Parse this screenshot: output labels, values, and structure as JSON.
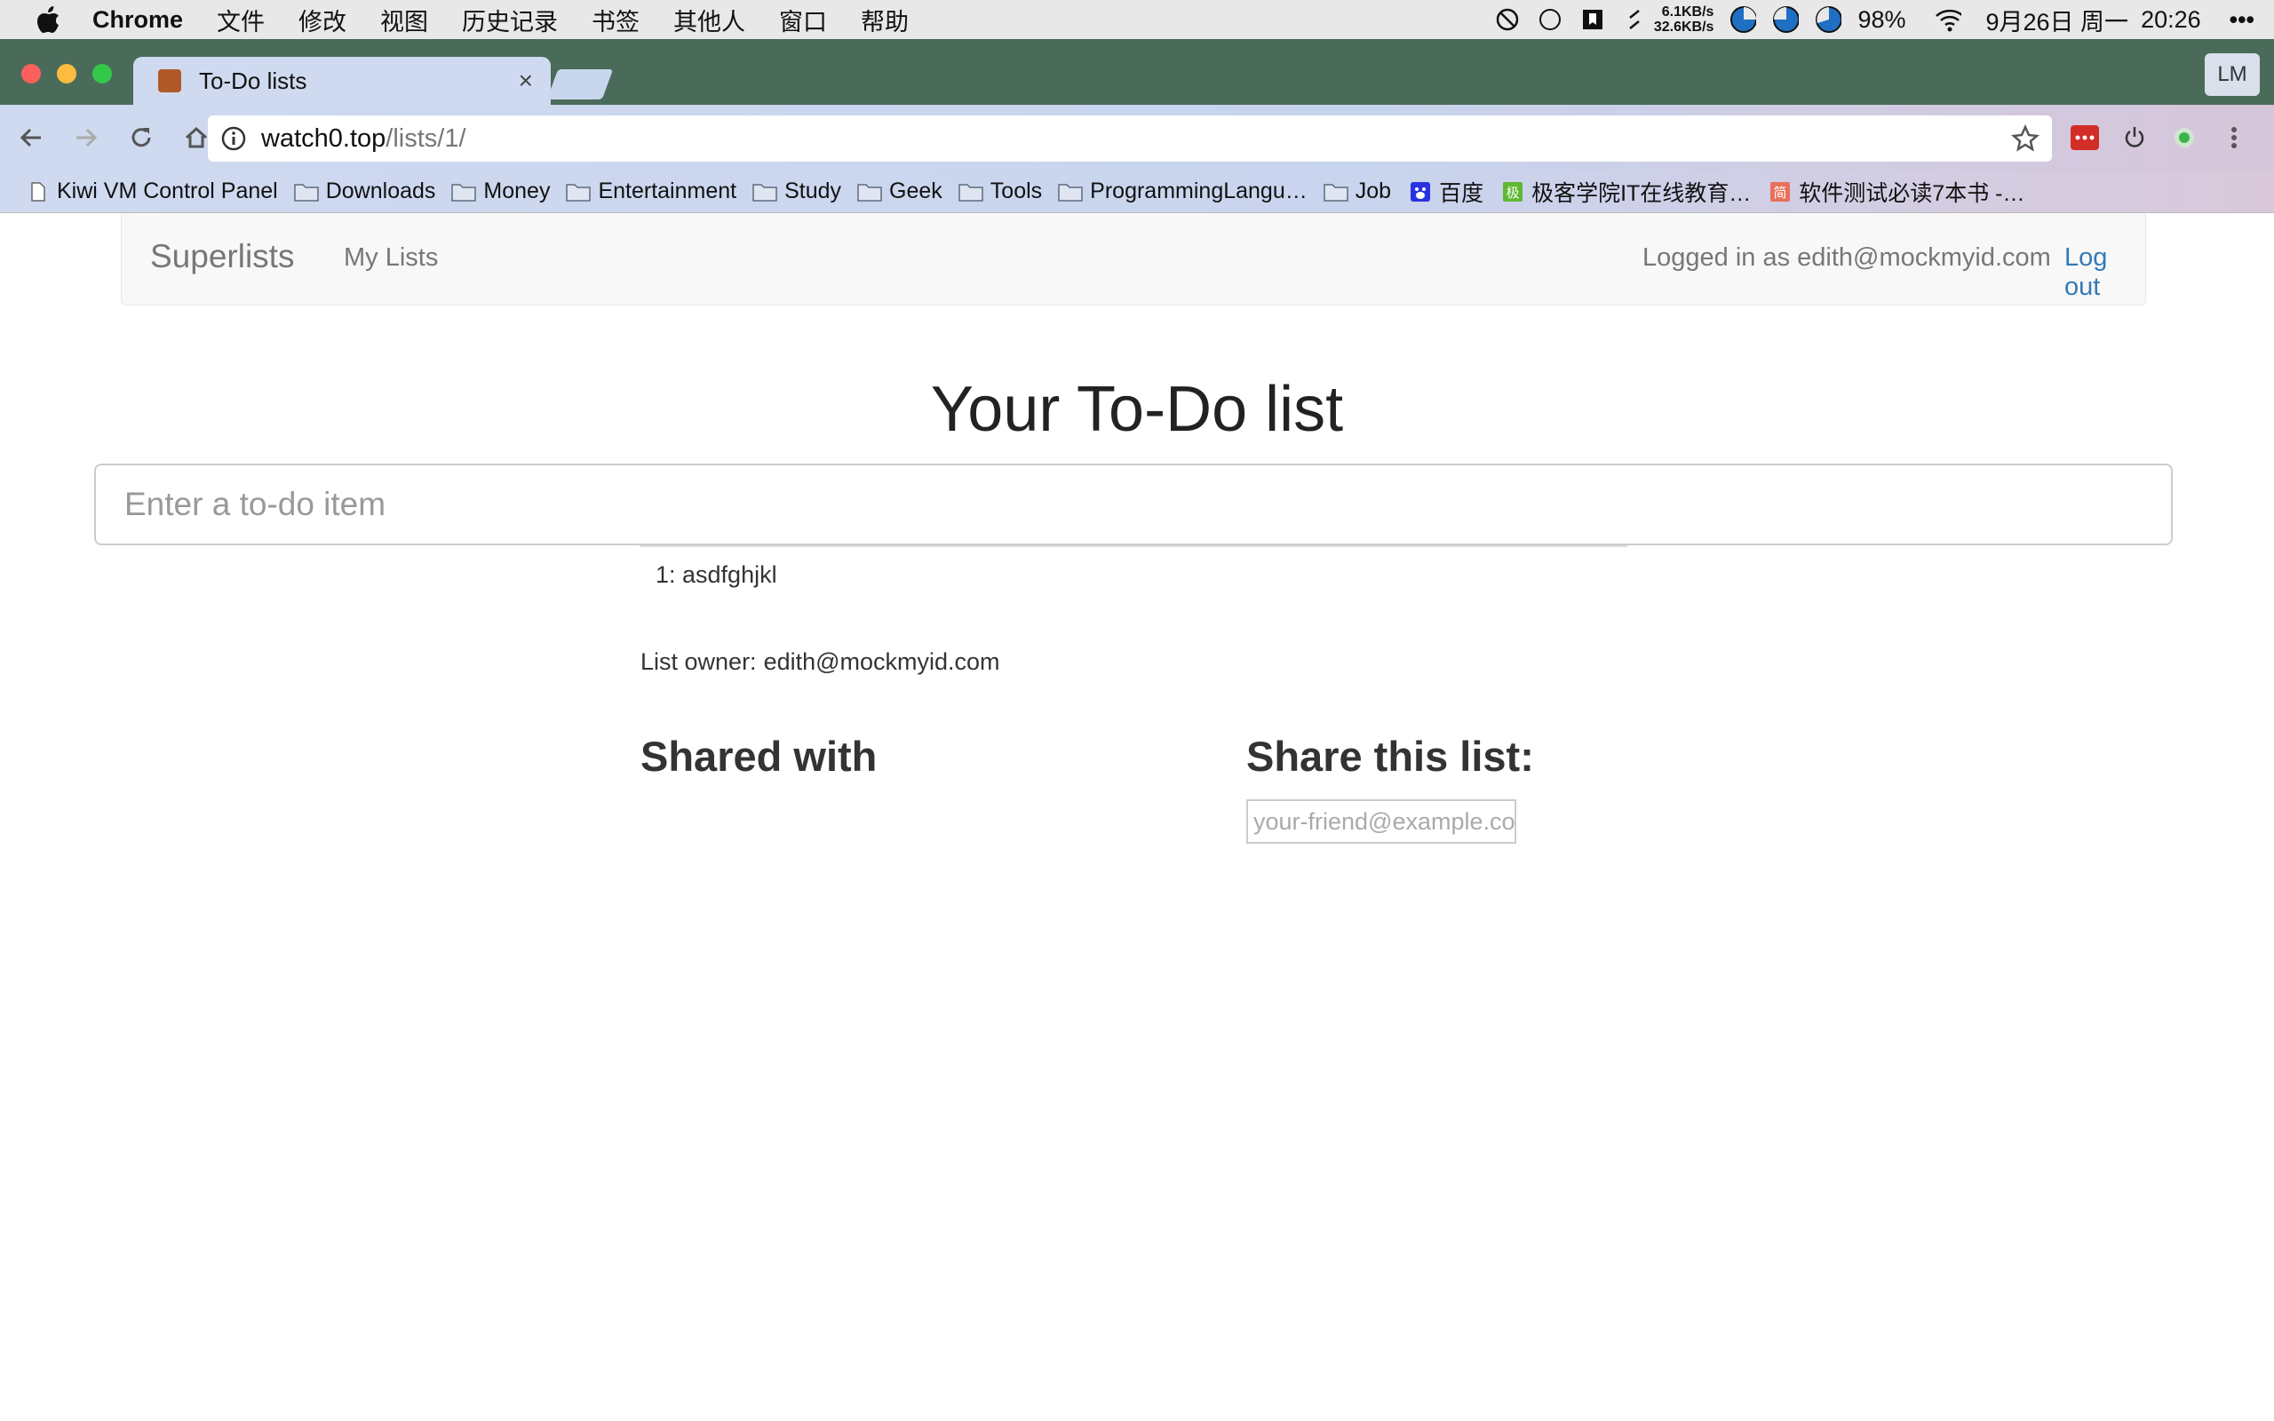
{
  "menubar": {
    "app_name": "Chrome",
    "items": [
      "文件",
      "修改",
      "视图",
      "历史记录",
      "书签",
      "其他人",
      "窗口",
      "帮助"
    ],
    "net_up": "6.1KB/s",
    "net_down": "32.6KB/s",
    "battery": "98%",
    "date": "9月26日 周一",
    "time": "20:26"
  },
  "browser": {
    "tab_title": "To-Do lists",
    "tab_close": "×",
    "profile": "LM",
    "url_host": "watch0.top",
    "url_path": "/lists/1/",
    "bookmarks": [
      {
        "label": "Kiwi VM Control Panel",
        "icon": "page-icon"
      },
      {
        "label": "Downloads",
        "icon": "folder-icon"
      },
      {
        "label": "Money",
        "icon": "folder-icon"
      },
      {
        "label": "Entertainment",
        "icon": "folder-icon"
      },
      {
        "label": "Study",
        "icon": "folder-icon"
      },
      {
        "label": "Geek",
        "icon": "folder-icon"
      },
      {
        "label": "Tools",
        "icon": "folder-icon"
      },
      {
        "label": "ProgrammingLangu…",
        "icon": "folder-icon"
      },
      {
        "label": "Job",
        "icon": "folder-icon"
      },
      {
        "label": "百度",
        "icon": "baidu-icon"
      },
      {
        "label": "极客学院IT在线教育…",
        "icon": "jike-icon"
      },
      {
        "label": "软件测试必读7本书 -…",
        "icon": "jianshu-icon"
      }
    ]
  },
  "page": {
    "brand": "Superlists",
    "nav_my_lists": "My Lists",
    "logged_in_text": "Logged in as edith@mockmyid.com",
    "logout": "Log out",
    "title": "Your To-Do list",
    "input_placeholder": "Enter a to-do item",
    "items": [
      "1: asdfghjkl"
    ],
    "owner_label": "List owner:",
    "owner_email": "edith@mockmyid.com",
    "shared_with_title": "Shared with",
    "share_title": "Share this list:",
    "share_placeholder": "your-friend@example.com"
  },
  "colors": {
    "link": "#337ab7",
    "tabstrip": "#4a6b5a",
    "tab": "#cfdaf0"
  }
}
